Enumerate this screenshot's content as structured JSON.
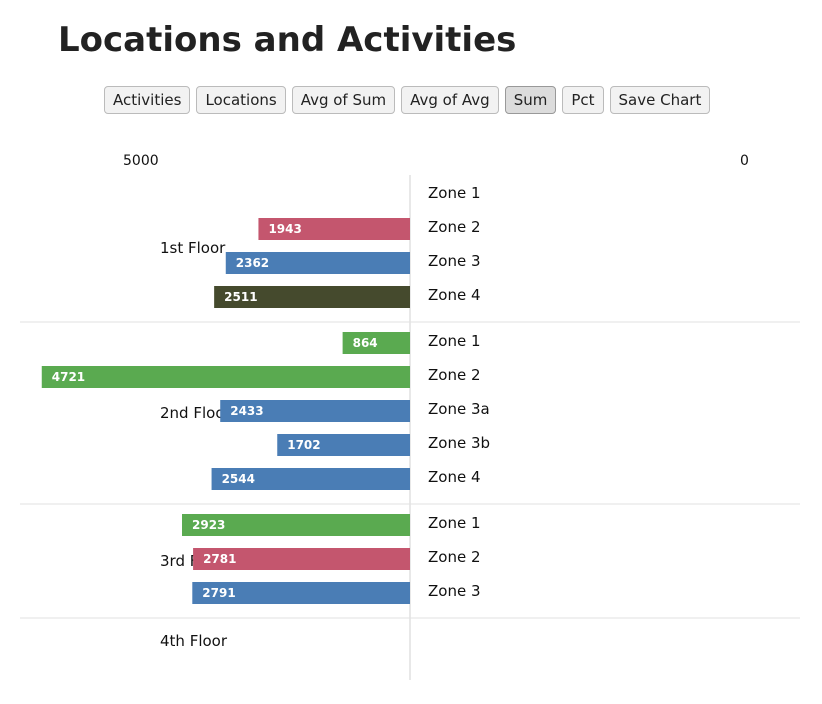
{
  "header": {
    "title": "Locations and Activities",
    "subtitle": ""
  },
  "toolbar": {
    "buttons": [
      {
        "label": "Activities",
        "active": false
      },
      {
        "label": "Locations",
        "active": false
      },
      {
        "label": "Avg of Sum",
        "active": false
      },
      {
        "label": "Avg of Avg",
        "active": false
      },
      {
        "label": "Sum",
        "active": true
      },
      {
        "label": "Pct",
        "active": false
      },
      {
        "label": "Save Chart",
        "active": false
      }
    ]
  },
  "chart_data": {
    "type": "bar",
    "orientation": "diverging-horizontal",
    "axis": {
      "left_tick": "5000",
      "right_tick": "0",
      "left_value": 5000,
      "right_value": 0
    },
    "colors": {
      "blue": "#4a7db5",
      "green": "#5aaa50",
      "pink": "#c4566e",
      "olive": "#454a2d"
    },
    "groups": [
      {
        "floor": "1st Floor",
        "zones": [
          {
            "zone": "Zone 1",
            "value": null,
            "color": "#4a7db5"
          },
          {
            "zone": "Zone 2",
            "value": 1943,
            "color": "#c4566e"
          },
          {
            "zone": "Zone 3",
            "value": 2362,
            "color": "#4a7db5"
          },
          {
            "zone": "Zone 4",
            "value": 2511,
            "color": "#454a2d"
          }
        ]
      },
      {
        "floor": "2nd Floor",
        "zones": [
          {
            "zone": "Zone 1",
            "value": 864,
            "color": "#5aaa50"
          },
          {
            "zone": "Zone 2",
            "value": 4721,
            "color": "#5aaa50"
          },
          {
            "zone": "Zone 3a",
            "value": 2433,
            "color": "#4a7db5"
          },
          {
            "zone": "Zone 3b",
            "value": 1702,
            "color": "#4a7db5"
          },
          {
            "zone": "Zone 4",
            "value": 2544,
            "color": "#4a7db5"
          }
        ]
      },
      {
        "floor": "3rd Floor",
        "zones": [
          {
            "zone": "Zone 1",
            "value": 2923,
            "color": "#5aaa50"
          },
          {
            "zone": "Zone 2",
            "value": 2781,
            "color": "#c4566e"
          },
          {
            "zone": "Zone 3",
            "value": 2791,
            "color": "#4a7db5"
          }
        ]
      },
      {
        "floor": "4th Floor",
        "zones": []
      }
    ]
  }
}
